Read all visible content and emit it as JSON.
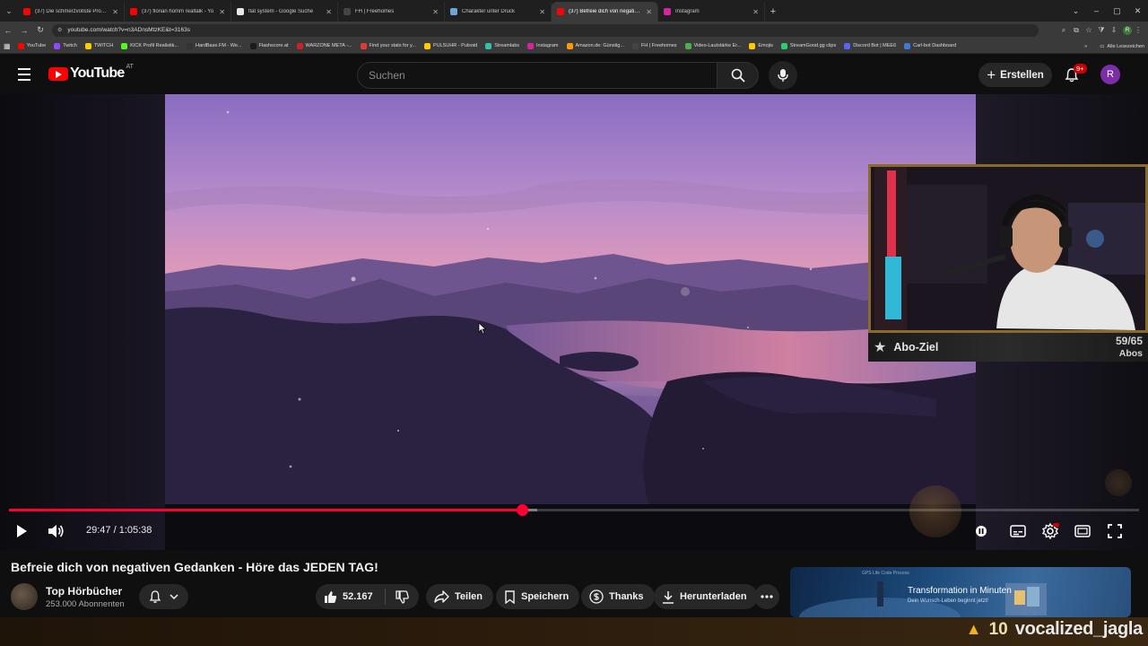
{
  "browser": {
    "tabs": [
      {
        "label": "(37) Die schmerzvollste Progno",
        "color": "#ff0000"
      },
      {
        "label": "(37) florian homm realtalk - Yo",
        "color": "#ff0000"
      },
      {
        "label": "flat system - Google Suche",
        "color": "#e8e8e8"
      },
      {
        "label": "FH | Freehomes",
        "color": "#444444"
      },
      {
        "label": "Charakter unter Druck",
        "color": "#6fa3d9"
      },
      {
        "label": "(37) Befreie dich von negativen",
        "color": "#ff0000",
        "active": true
      },
      {
        "label": "Instagram",
        "color": "#d6249f"
      }
    ],
    "url": "youtube.com/watch?v=n3ADnsMtzKE&t=3163s",
    "bookmarks": [
      {
        "label": "YouTube",
        "color": "#ff0000"
      },
      {
        "label": "Twitch",
        "color": "#9146ff"
      },
      {
        "label": "TWITCH",
        "color": "#ffcc00"
      },
      {
        "label": "KICK Profil Realistik...",
        "color": "#53fc18"
      },
      {
        "label": "HardBase.FM - We...",
        "color": "#333333"
      },
      {
        "label": "Flashscore.at",
        "color": "#1b1b1b"
      },
      {
        "label": "WARZONE META -...",
        "color": "#cc2222"
      },
      {
        "label": "Find your stats for y...",
        "color": "#e53935"
      },
      {
        "label": "PULSUHR - Pulsoid",
        "color": "#ffcc00"
      },
      {
        "label": "Streamlabs",
        "color": "#31c3a2"
      },
      {
        "label": "Instagram",
        "color": "#d6249f"
      },
      {
        "label": "Amazon.de: Günstig...",
        "color": "#ff9900"
      },
      {
        "label": "FH | Freehomes",
        "color": "#444444"
      },
      {
        "label": "Video-Lautstärke Er...",
        "color": "#4caf50"
      },
      {
        "label": "Emojis",
        "color": "#ffcc00"
      },
      {
        "label": "StreamGood.gg clips",
        "color": "#2ecc71"
      },
      {
        "label": "Discord Bot | MEE6",
        "color": "#5865f2"
      },
      {
        "label": "Carl-bot Dashboard",
        "color": "#3a7bd5"
      }
    ],
    "bookmarks_more": "»",
    "all_bookmarks": "Alle Lesezeichen"
  },
  "youtube": {
    "logo_text": "YouTube",
    "country": "AT",
    "search_placeholder": "Suchen",
    "create_label": "Erstellen",
    "notifications_badge": "9+",
    "avatar_letter": "R"
  },
  "player": {
    "time_current": "29:47",
    "time_separator": " / ",
    "time_total": "1:05:38",
    "progress_played": 0.4537,
    "progress_buffered": 0.4675,
    "overlay": {
      "label": "Abo-Ziel",
      "count": "59/65",
      "unit": "Abos"
    }
  },
  "video": {
    "title": "Befreie dich von negativen Gedanken - Höre das JEDEN TAG!",
    "channel": "Top Hörbücher",
    "subscribers": "253.000 Abonnenten",
    "likes": "52.167",
    "share_label": "Teilen",
    "save_label": "Speichern",
    "thanks_label": "Thanks",
    "download_label": "Herunterladen"
  },
  "ad": {
    "top": "GPS Life Code Process",
    "headline": "Transformation in Minuten",
    "sub": "Dein Wunsch-Leben beginnt jetzt!"
  },
  "stream_overlay": {
    "count": "10",
    "username": "vocalized_jagla"
  }
}
